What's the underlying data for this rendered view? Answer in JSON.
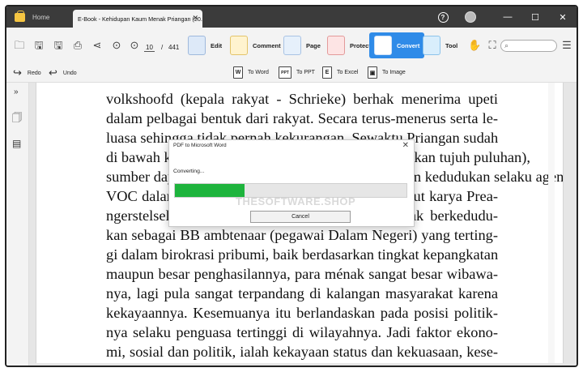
{
  "titlebar": {
    "home_tab": "Home",
    "document_tab": "E-Book - Kehidupan Kaum Menak Priangan (20..."
  },
  "toolbar": {
    "current_page": "10",
    "total_pages": "441",
    "features": [
      {
        "label": "Edit",
        "icon": "edit-icon"
      },
      {
        "label": "Comment",
        "icon": "comment-icon"
      },
      {
        "label": "Page",
        "icon": "page-icon"
      },
      {
        "label": "Protect",
        "icon": "protect-icon"
      },
      {
        "label": "Convert",
        "icon": "convert-icon"
      },
      {
        "label": "Tool",
        "icon": "tool-icon"
      }
    ],
    "redo": "Redo",
    "undo": "Undo",
    "convert_options": [
      {
        "label": "To Word",
        "glyph": "W"
      },
      {
        "label": "To PPT",
        "glyph": "PPT"
      },
      {
        "label": "To Excel",
        "glyph": "E"
      },
      {
        "label": "To Image",
        "glyph": "▣"
      }
    ]
  },
  "document": {
    "lines": [
      "volkshoofd (kepala rakyat - Schrieke) berhak menerima upeti",
      "dalam pelbagai bentuk dari rakyat. Secara terus-menerus serta le-",
      "luasa sehingga tidak pernah kekurangan. Sewaktu Priangan sudah",
      "di bawah kekuasaan Kompeni (beberapa puluh, bahkan tujuh puluhan),",
      "sumber daya ekonomi para menak kian besar. Dalam kedudukan selaku agen",
      "VOC dalam wujud jasa dan barang. Bahkan menurut karya Prea-",
      "ngerstelsel yang masih berlaku dan sebagai menak berkedudu-",
      "kan sebagai BB ambtenaar (pegawai Dalam Negeri) yang terting-",
      "gi dalam birokrasi pribumi, baik berdasarkan tingkat kepangkatan",
      "maupun besar penghasilannya, para ménak sangat besar wibawa-",
      "nya, lagi pula sangat terpandang di kalangan masyarakat karena",
      "kekayaannya. Kesemuanya itu berlandaskan pada posisi politik-",
      "nya selaku penguasa tertinggi di wilayahnya. Jadi faktor ekono-",
      "mi, sosial dan politik, ialah kekayaan status dan kekuasaan, kese-"
    ]
  },
  "dialog": {
    "title": "PDF to Microsoft Word",
    "status": "Converting...",
    "progress_percent": 30,
    "watermark": "THESOFTWARE.SHOP",
    "cancel_label": "Cancel"
  },
  "colors": {
    "titlebar": "#3b3b3b",
    "accent": "#2f8be8",
    "progress": "#1eb43d"
  }
}
